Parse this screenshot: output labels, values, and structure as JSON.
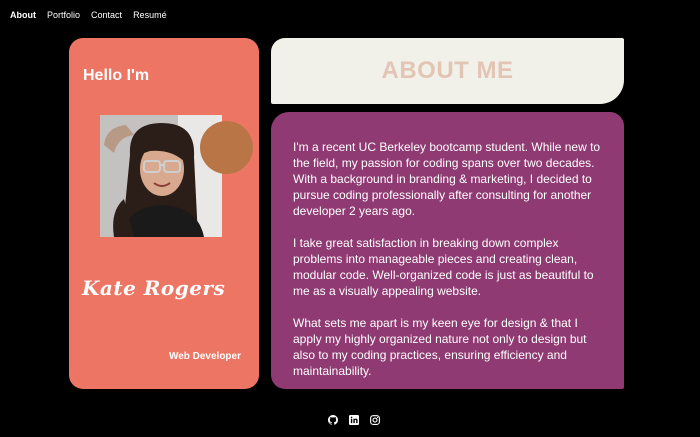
{
  "nav": {
    "items": [
      {
        "label": "About",
        "active": true
      },
      {
        "label": "Portfolio",
        "active": false
      },
      {
        "label": "Contact",
        "active": false
      },
      {
        "label": "Resumé",
        "active": false
      }
    ]
  },
  "profile": {
    "greeting": "Hello I'm",
    "name": "Kate Rogers",
    "role": "Web Developer"
  },
  "about": {
    "title": "ABOUT ME",
    "paragraphs": [
      "I'm a recent UC Berkeley bootcamp student. While new to the field, my passion for coding spans over two decades. With a background in branding & marketing, I decided to pursue coding professionally after consulting for another developer 2 years ago.",
      "I take great satisfaction in breaking down complex problems into manageable pieces and creating clean, modular code. Well-organized code is just as beautiful to me as a visually appealing website.",
      "What sets me apart is my keen eye for design & that I apply my highly organized nature not only to design but also to my coding practices, ensuring efficiency and maintainability."
    ]
  },
  "footer": {
    "icons": [
      "github-icon",
      "linkedin-icon",
      "instagram-icon"
    ]
  },
  "colors": {
    "background": "#000000",
    "profile_card": "#ed7563",
    "about_banner": "#f1f0e9",
    "about_title": "#e3c5b5",
    "bio_card": "#8f3a72",
    "accent_circle": "#b97546"
  }
}
